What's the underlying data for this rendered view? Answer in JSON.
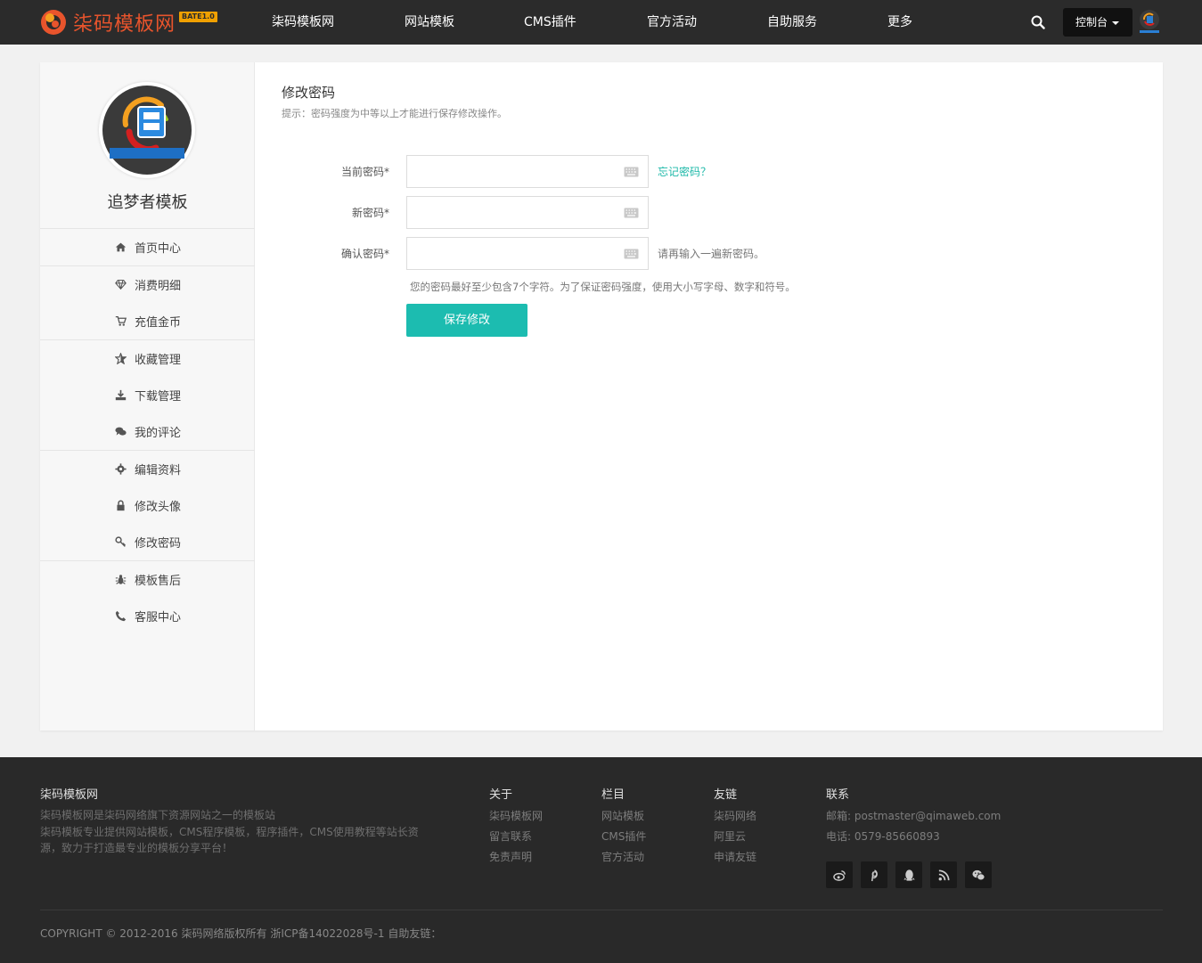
{
  "header": {
    "brand": "柒码模板网",
    "badge": "BATE1.0",
    "nav": [
      "柒码模板网",
      "网站模板",
      "CMS插件",
      "官方活动",
      "自助服务",
      "更多"
    ],
    "console_label": "控制台"
  },
  "sidebar": {
    "profile_name": "追梦者模板",
    "avatar_text": "追梦者模板",
    "items": [
      {
        "label": "首页中心",
        "icon": "home-icon"
      },
      {
        "label": "消费明细",
        "icon": "diamond-icon"
      },
      {
        "label": "充值金币",
        "icon": "cart-icon"
      },
      {
        "label": "收藏管理",
        "icon": "star-icon"
      },
      {
        "label": "下载管理",
        "icon": "download-icon"
      },
      {
        "label": "我的评论",
        "icon": "comments-icon"
      },
      {
        "label": "编辑资料",
        "icon": "gear-icon"
      },
      {
        "label": "修改头像",
        "icon": "lock-icon"
      },
      {
        "label": "修改密码",
        "icon": "key-icon"
      },
      {
        "label": "模板售后",
        "icon": "bug-icon"
      },
      {
        "label": "客服中心",
        "icon": "phone-icon"
      }
    ]
  },
  "content": {
    "title": "修改密码",
    "hint": "提示：密码强度为中等以上才能进行保存修改操作。",
    "fields": [
      {
        "label": "当前密码*",
        "value": ""
      },
      {
        "label": "新密码*",
        "value": ""
      },
      {
        "label": "确认密码*",
        "value": ""
      }
    ],
    "forgot_link": "忘记密码？",
    "confirm_hint": "请再输入一遍新密码。",
    "password_tip": "您的密码最好至少包含7个字符。为了保证密码强度，使用大小写字母、数字和符号。",
    "save_label": "保存修改"
  },
  "footer": {
    "about_title": "柒码模板网",
    "about_lines": [
      "柒码模板网是柒码网络旗下资源网站之一的模板站",
      "柒码模板专业提供网站模板，CMS程序模板，程序插件，CMS使用教程等站长资",
      "源，致力于打造最专业的模板分享平台！"
    ],
    "columns": [
      {
        "title": "关于",
        "links": [
          "柒码模板网",
          "留言联系",
          "免责声明"
        ]
      },
      {
        "title": "栏目",
        "links": [
          "网站模板",
          "CMS插件",
          "官方活动"
        ]
      },
      {
        "title": "友链",
        "links": [
          "柒码网络",
          "阿里云",
          "申请友链"
        ]
      }
    ],
    "contact_title": "联系",
    "email": "邮箱: postmaster@qimaweb.com",
    "phone": "电话: 0579-85660893",
    "social": [
      "weibo-icon",
      "pinterest-icon",
      "qq-icon",
      "rss-icon",
      "wechat-icon"
    ],
    "copyright": "COPYRIGHT © 2012-2016 柒码网络版权所有 浙ICP备14022028号-1 自助友链："
  },
  "colors": {
    "accent": "#1cbcb0",
    "header_bg": "#2b2b2b",
    "footer_bg": "#292929",
    "brand": "#e8542c"
  }
}
